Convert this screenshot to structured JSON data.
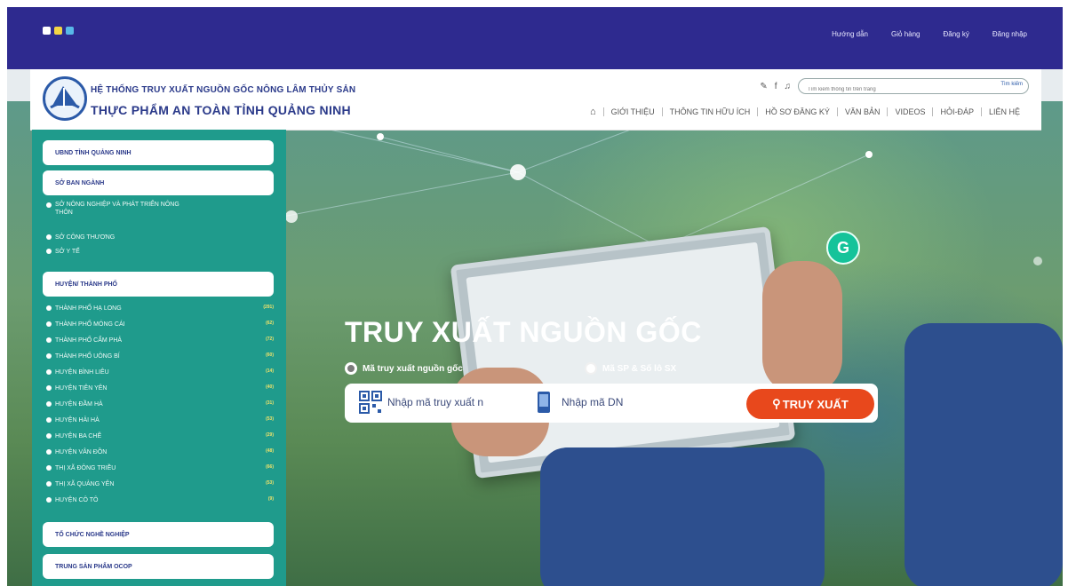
{
  "colors": {
    "topbar": "#2e2a8f",
    "sidebar": "#1f9b8c",
    "brand_text": "#2b3a8a",
    "search_button": "#e8481c",
    "count_badge": "#f1e36b"
  },
  "top_bar": {
    "dots": [
      "#ffffff",
      "#f3d545",
      "#58b8e8"
    ],
    "links": [
      "Hướng dẫn",
      "Giỏ hàng",
      "Đăng ký",
      "Đăng nhập"
    ]
  },
  "header": {
    "title_line1": "HỆ THỐNG TRUY XUẤT NGUỒN GỐC NÔNG LÂM THỦY SẢN",
    "title_line2": "THỰC PHẨM AN TOÀN TỈNH QUẢNG NINH",
    "utility_icons": [
      "phone-icon",
      "facebook-icon",
      "bell-icon"
    ],
    "search": {
      "placeholder": "Tìm kiếm thông tin trên trang",
      "button_label": "Tìm kiếm"
    },
    "menu": [
      "GIỚI THIỆU",
      "THÔNG TIN HỮU ÍCH",
      "HỒ SƠ ĐĂNG KÝ",
      "VĂN BẢN",
      "VIDEOS",
      "HỎI-ĐÁP",
      "LIÊN HỆ"
    ]
  },
  "sidebar": {
    "sections": [
      "UBND TỈNH QUẢNG NINH",
      "SỞ BAN NGÀNH",
      "HUYỆN/ THÀNH PHỐ",
      "TỔ CHỨC NGHỀ NGHIỆP",
      "TRUNG SẢN PHẨM OCOP"
    ],
    "departments": [
      "SỞ NÔNG NGHIỆP VÀ PHÁT TRIỂN NÔNG THÔN",
      "SỞ CÔNG THƯƠNG",
      "SỞ Y TẾ"
    ],
    "districts": [
      {
        "name": "THÀNH PHỐ HẠ LONG",
        "count": "(291)"
      },
      {
        "name": "THÀNH PHỐ MÓNG CÁI",
        "count": "(62)"
      },
      {
        "name": "THÀNH PHỐ CẨM PHẢ",
        "count": "(72)"
      },
      {
        "name": "THÀNH PHỐ UÔNG BÍ",
        "count": "(60)"
      },
      {
        "name": "HUYỆN BÌNH LIÊU",
        "count": "(14)"
      },
      {
        "name": "HUYỆN TIÊN YÊN",
        "count": "(40)"
      },
      {
        "name": "HUYỆN ĐẦM HÀ",
        "count": "(31)"
      },
      {
        "name": "HUYỆN HẢI HÀ",
        "count": "(53)"
      },
      {
        "name": "HUYỆN BA CHẼ",
        "count": "(29)"
      },
      {
        "name": "HUYỆN VÂN ĐỒN",
        "count": "(48)"
      },
      {
        "name": "THỊ XÃ ĐÔNG TRIỀU",
        "count": "(66)"
      },
      {
        "name": "THỊ XÃ QUẢNG YÊN",
        "count": "(53)"
      },
      {
        "name": "HUYỆN CÔ TÔ",
        "count": "(9)"
      }
    ]
  },
  "hero": {
    "title": "TRUY XUẤT NGUỒN GỐC",
    "radio_options": [
      {
        "label": "Mã truy xuất nguồn gốc",
        "selected": true
      },
      {
        "label": "Mã SP & Số lô SX",
        "selected": false
      }
    ],
    "field1_text": "Nhập mã truy xuất n",
    "field2_text": "Nhập mã DN",
    "search_button": "TRUY XUẤT",
    "grammarly": "G"
  }
}
